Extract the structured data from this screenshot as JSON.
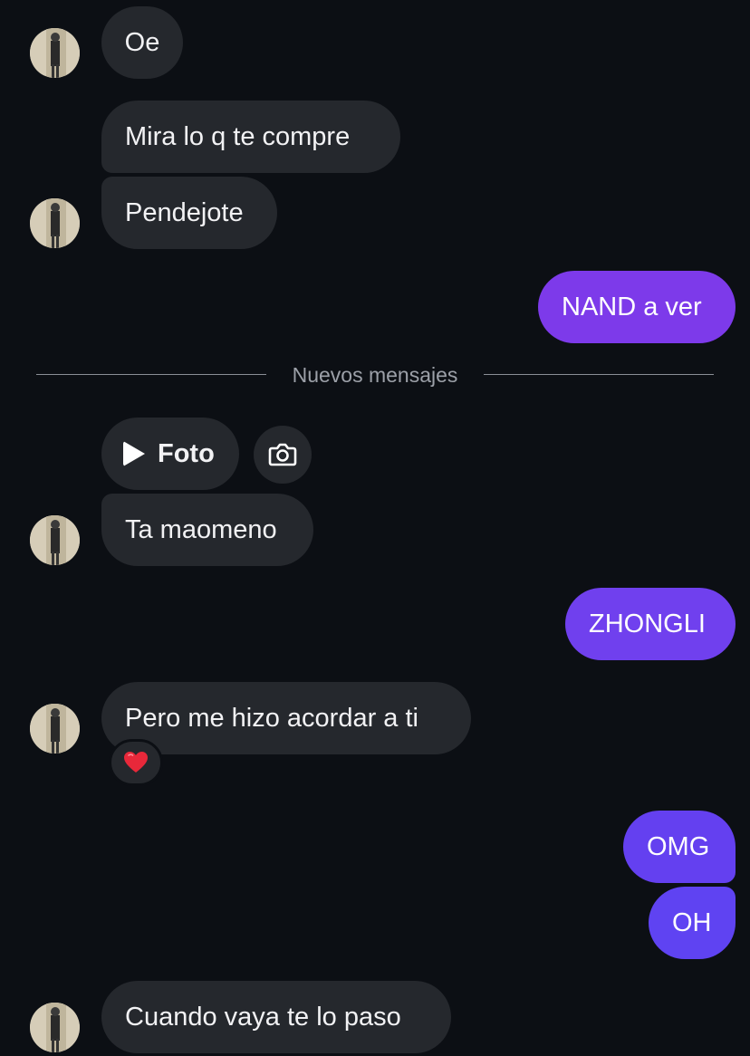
{
  "messages": [
    {
      "text": "Oe"
    },
    {
      "text": "Mira lo q te compre"
    },
    {
      "text": "Pendejote"
    },
    {
      "text": "NAND a ver"
    },
    {
      "text": "Ta maomeno"
    },
    {
      "text": "ZHONGLI"
    },
    {
      "text": "Pero me hizo acordar a ti"
    },
    {
      "text": "OMG"
    },
    {
      "text": "OH"
    },
    {
      "text": "Cuando vaya te lo paso"
    }
  ],
  "divider": {
    "label": "Nuevos mensajes"
  },
  "attachment": {
    "label": "Foto",
    "icon": "play-icon",
    "action_icon": "camera-icon"
  },
  "reaction": {
    "icon": "red-heart-icon"
  },
  "colors": {
    "background": "#0c0f14",
    "incoming_bubble": "#25282d",
    "outgoing_bubble": "#6a3ff0",
    "text": "#f2f2f4",
    "divider_text": "#9ca0a8"
  }
}
